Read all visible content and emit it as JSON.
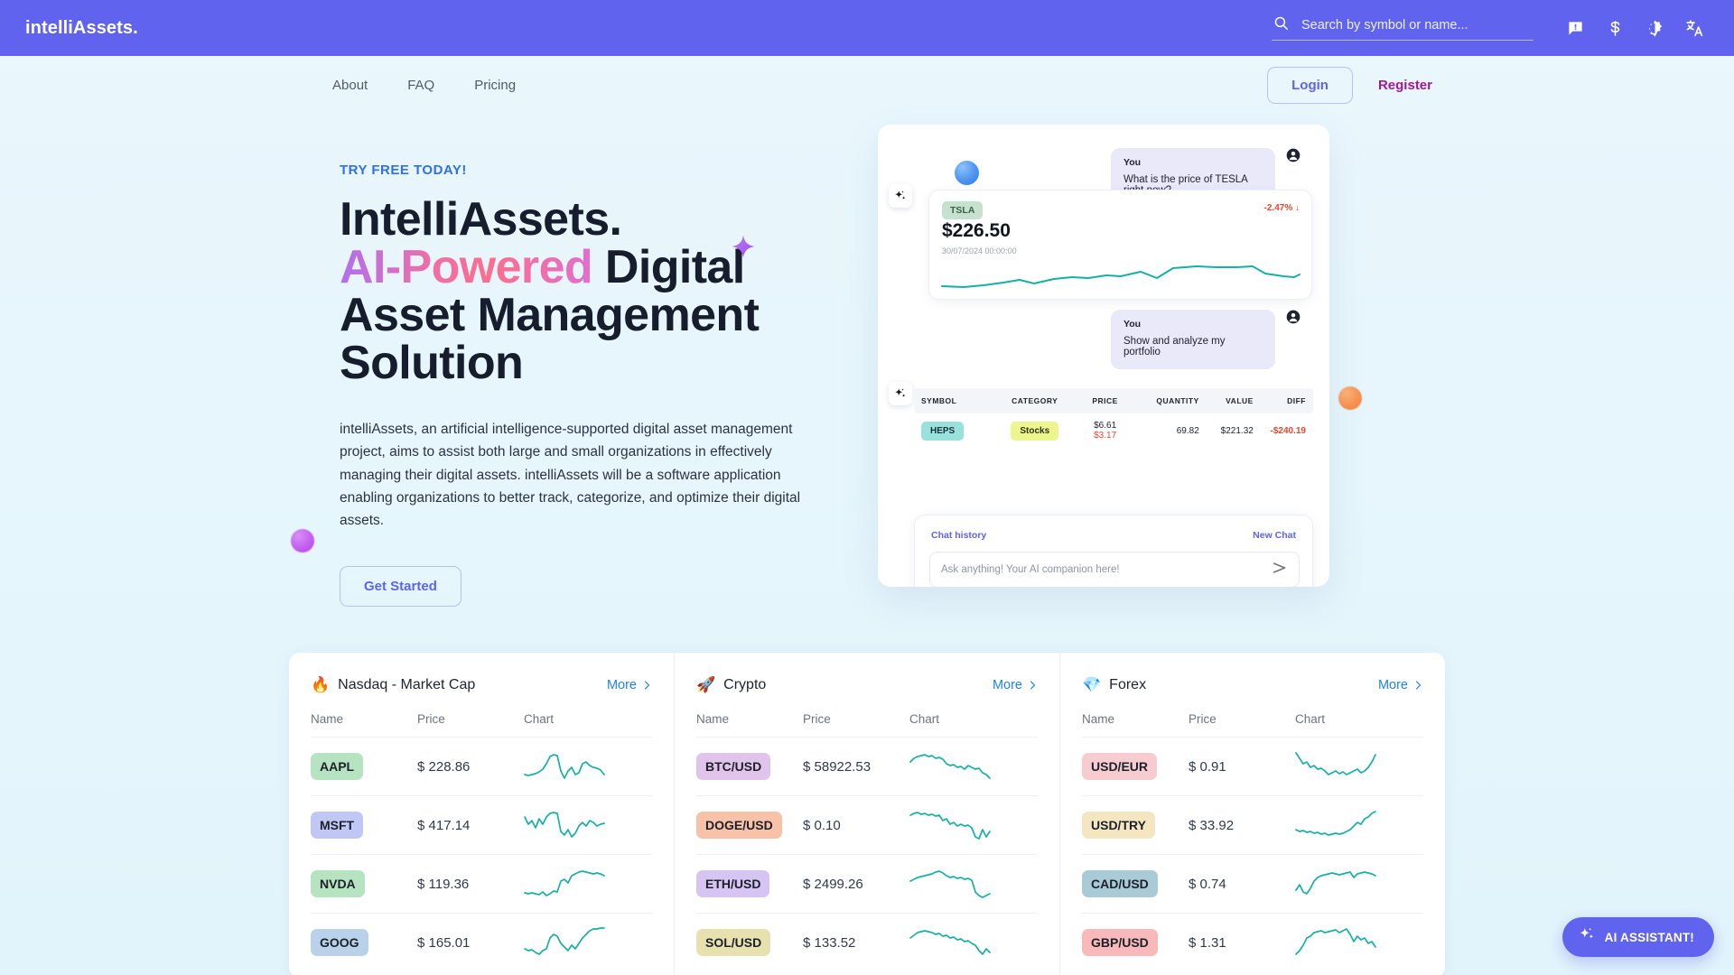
{
  "appbar": {
    "brand": "intelliAssets.",
    "search_placeholder": "Search by symbol or name...",
    "search_value": "",
    "icons": [
      "feedback-icon",
      "currency-icon",
      "dark-mode-icon",
      "language-icon"
    ]
  },
  "nav": {
    "links": [
      {
        "label": "About"
      },
      {
        "label": "FAQ"
      },
      {
        "label": "Pricing"
      }
    ],
    "login_label": "Login",
    "register_label": "Register"
  },
  "hero": {
    "eyebrow": "TRY FREE TODAY!",
    "title_line1": "IntelliAssets.",
    "title_highlight": "AI-Powered",
    "title_rest": " Digital Asset Management Solution",
    "paragraph": "intelliAssets, an artificial intelligence-supported digital asset management project, aims to assist both large and small organizations in effectively managing their digital assets. intelliAssets will be a software application enabling organizations to better track, categorize, and optimize their digital assets.",
    "cta_label": "Get Started"
  },
  "mockup": {
    "message1": {
      "who": "You",
      "text": "What is the price of TESLA right now?"
    },
    "quote": {
      "symbol": "TSLA",
      "price": "$226.50",
      "timestamp": "30/07/2024 00:00:00",
      "change": "-2.47% ↓"
    },
    "message2": {
      "who": "You",
      "text": "Show and analyze my portfolio"
    },
    "portfolio": {
      "headers": [
        "SYMBOL",
        "CATEGORY",
        "PRICE",
        "QUANTITY",
        "VALUE",
        "DIFF"
      ],
      "rows": [
        {
          "symbol": "HEPS",
          "category": "Stocks",
          "price": "$6.61",
          "price_sub": "$3.17",
          "quantity": "69.82",
          "value": "$221.32",
          "diff": "-$240.19"
        }
      ]
    },
    "chat": {
      "history_label": "Chat history",
      "new_chat_label": "New Chat",
      "input_placeholder": "Ask anything! Your AI companion here!",
      "input_value": ""
    }
  },
  "markets": {
    "more_label": "More",
    "columns": [
      {
        "name": "Name"
      },
      {
        "name": "Price"
      },
      {
        "name": "Chart"
      }
    ],
    "cards": [
      {
        "emoji": "🔥",
        "title": "Nasdaq - Market Cap",
        "rows": [
          {
            "symbol": "AAPL",
            "price": "$ 228.86",
            "chip_bg": "#b6e3c0",
            "spark": [
              26,
              27,
              26,
              25,
              23,
              20,
              14,
              6,
              4,
              5,
              22,
              30,
              22,
              18,
              26,
              24,
              14,
              12,
              16,
              18,
              19,
              21,
              26
            ]
          },
          {
            "symbol": "MSFT",
            "price": "$ 417.14",
            "chip_bg": "#c1c7f5",
            "spark": [
              8,
              16,
              12,
              20,
              10,
              16,
              8,
              4,
              3,
              4,
              24,
              28,
              22,
              30,
              26,
              18,
              14,
              18,
              12,
              14,
              18,
              16,
              15
            ]
          },
          {
            "symbol": "NVDA",
            "price": "$ 119.36",
            "chip_bg": "#b6e3c0",
            "spark": [
              27,
              28,
              27,
              28,
              29,
              26,
              30,
              28,
              25,
              26,
              14,
              12,
              16,
              8,
              6,
              4,
              3,
              4,
              5,
              6,
              5,
              6,
              8
            ]
          },
          {
            "symbol": "GOOG",
            "price": "$ 165.01",
            "chip_bg": "#b9d2ea",
            "spark": [
              24,
              26,
              25,
              28,
              30,
              26,
              24,
              12,
              8,
              10,
              18,
              22,
              26,
              20,
              24,
              18,
              12,
              8,
              4,
              2,
              2,
              1,
              1
            ]
          }
        ]
      },
      {
        "emoji": "🚀",
        "title": "Crypto",
        "rows": [
          {
            "symbol": "BTC/USD",
            "price": "$ 58922.53",
            "chip_bg": "#e0c4ec",
            "spark": [
              12,
              8,
              6,
              5,
              4,
              6,
              5,
              8,
              7,
              9,
              14,
              16,
              15,
              18,
              17,
              20,
              16,
              18,
              20,
              19,
              24,
              26,
              30
            ]
          },
          {
            "symbol": "DOGE/USD",
            "price": "$ 0.10",
            "chip_bg": "#f7c2a8",
            "spark": [
              6,
              4,
              3,
              5,
              4,
              6,
              5,
              7,
              6,
              12,
              10,
              16,
              14,
              18,
              16,
              18,
              17,
              20,
              30,
              32,
              22,
              30,
              24
            ]
          },
          {
            "symbol": "ETH/USD",
            "price": "$ 2499.26",
            "chip_bg": "#d6c4f2",
            "spark": [
              14,
              12,
              10,
              9,
              8,
              7,
              6,
              4,
              3,
              5,
              8,
              10,
              9,
              11,
              10,
              12,
              11,
              13,
              26,
              30,
              32,
              30,
              28
            ]
          },
          {
            "symbol": "SOL/USD",
            "price": "$ 133.52",
            "chip_bg": "#e7e1b0",
            "spark": [
              12,
              9,
              6,
              5,
              4,
              5,
              6,
              8,
              7,
              10,
              9,
              12,
              11,
              14,
              13,
              16,
              15,
              18,
              20,
              26,
              30,
              24,
              28
            ]
          }
        ]
      },
      {
        "emoji": "💎",
        "title": "Forex",
        "rows": [
          {
            "symbol": "USD/EUR",
            "price": "$ 0.91",
            "chip_bg": "#f6ccd0",
            "spark": [
              2,
              8,
              14,
              12,
              18,
              16,
              20,
              19,
              22,
              26,
              24,
              22,
              25,
              23,
              26,
              24,
              22,
              20,
              24,
              22,
              18,
              12,
              4
            ]
          },
          {
            "symbol": "USD/TRY",
            "price": "$ 33.92",
            "chip_bg": "#f3e6c1",
            "spark": [
              22,
              24,
              23,
              25,
              24,
              26,
              25,
              27,
              26,
              28,
              27,
              26,
              27,
              26,
              24,
              22,
              18,
              14,
              16,
              10,
              8,
              4,
              2
            ]
          },
          {
            "symbol": "CAD/USD",
            "price": "$ 0.74",
            "chip_bg": "#a9cbd7",
            "spark": [
              24,
              18,
              26,
              28,
              22,
              14,
              10,
              8,
              7,
              6,
              5,
              6,
              7,
              6,
              5,
              4,
              10,
              6,
              5,
              4,
              5,
              6,
              8
            ]
          },
          {
            "symbol": "GBP/USD",
            "price": "$ 1.31",
            "chip_bg": "#f7b9ba",
            "spark": [
              30,
              26,
              20,
              12,
              10,
              6,
              5,
              4,
              6,
              5,
              4,
              3,
              6,
              4,
              2,
              8,
              16,
              10,
              14,
              12,
              18,
              16,
              22
            ]
          }
        ]
      }
    ]
  },
  "fab": {
    "label": "AI ASSISTANT!"
  },
  "colors": {
    "brand_indigo": "#5f63ed",
    "register_magenta": "#a0189c",
    "eyebrow_blue": "#2f6fee",
    "spark_teal": "#16b0a4",
    "link_blue": "#1e82f5",
    "negative_red": "#e8452f"
  }
}
